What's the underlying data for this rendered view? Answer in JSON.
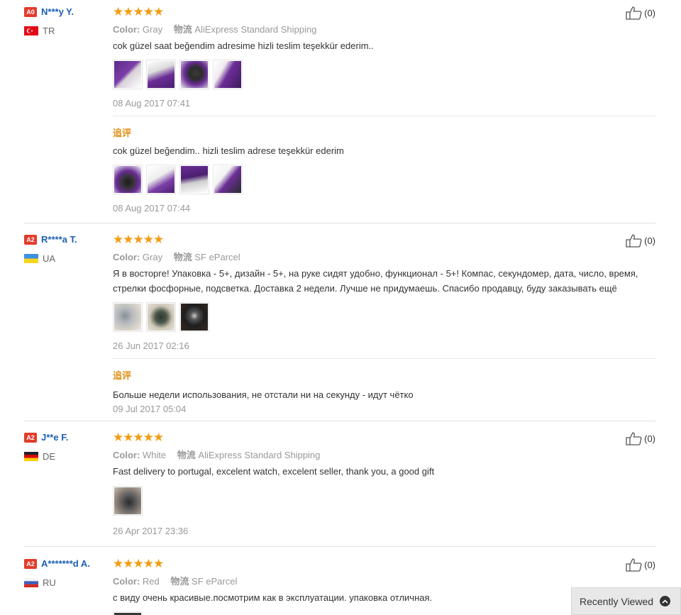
{
  "reviews": [
    {
      "level": "A0",
      "user": "N***y Y.",
      "country": "TR",
      "stars": "★★★★★",
      "color_label": "Color:",
      "color_value": "Gray",
      "ship_label": "物流",
      "ship_value": "AliExpress Standard Shipping",
      "text": "cok güzel saat beğendim adresime hizli teslim teşekkür ederim..",
      "date": "08 Aug 2017 07:41",
      "append_label": "追评",
      "append_text": "cok güzel beğendim.. hizli teslim adrese teşekkür ederim",
      "append_date": "08 Aug 2017 07:44",
      "helpful": "(0)"
    },
    {
      "level": "A2",
      "user": "R****a T.",
      "country": "UA",
      "stars": "★★★★★",
      "color_label": "Color:",
      "color_value": "Gray",
      "ship_label": "物流",
      "ship_value": "SF eParcel",
      "text": "Я в восторге! Упаковка - 5+, дизайн - 5+, на руке сидят удобно, функционал - 5+! Компас, секундомер, дата, число, время, стрелки фосфорные, подсветка. Доставка 2 недели. Лучше не придумаешь. Спасибо продавцу, буду заказывать ещё",
      "date": "26 Jun 2017 02:16",
      "append_label": "追评",
      "append_text": "Больше недели использования, не отстали ни на секунду - идут чётко",
      "append_date": "09 Jul 2017 05:04",
      "helpful": "(0)"
    },
    {
      "level": "A2",
      "user": "J**e F.",
      "country": "DE",
      "stars": "★★★★★",
      "color_label": "Color:",
      "color_value": "White",
      "ship_label": "物流",
      "ship_value": "AliExpress Standard Shipping",
      "text": "Fast delivery to portugal, excelent watch, excelent seller, thank you, a good gift",
      "date": "26 Apr 2017 23:36",
      "helpful": "(0)"
    },
    {
      "level": "A2",
      "user": "A*******d A.",
      "country": "RU",
      "stars": "★★★★★",
      "color_label": "Color:",
      "color_value": "Red",
      "ship_label": "物流",
      "ship_value": "SF eParcel",
      "text": "с виду очень красивые.посмотрим как в эксплуатации. упаковка отличная.",
      "helpful": "(0)"
    }
  ],
  "recently_viewed": "Recently Viewed",
  "colors": {
    "star": "#f39c12",
    "link": "#1c5fb0",
    "badge": "#e23b2a",
    "append": "#e08e15"
  }
}
